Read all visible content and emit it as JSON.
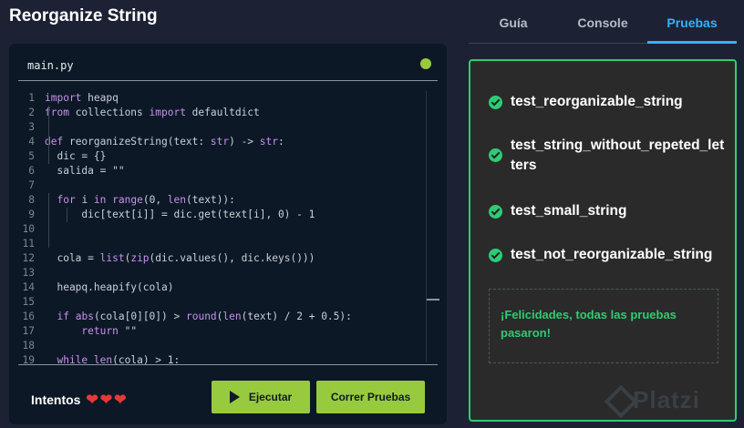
{
  "page_title": "Reorganize String",
  "editor": {
    "file_name": "main.py",
    "lines": [
      {
        "n": "1",
        "html": "<span class=\"kw\">import</span> heapq"
      },
      {
        "n": "2",
        "html": "<span class=\"kw\">from</span> collections <span class=\"kw\">import</span> defaultdict"
      },
      {
        "n": "3",
        "html": ""
      },
      {
        "n": "4",
        "html": "<span class=\"kw\">def</span> reorganizeString(text: <span class=\"kw\">str</span>) -> <span class=\"kw\">str</span>:"
      },
      {
        "n": "5",
        "html": "  dic = {}"
      },
      {
        "n": "6",
        "html": "  salida = \"\""
      },
      {
        "n": "7",
        "html": ""
      },
      {
        "n": "8",
        "html": "  <span class=\"kw\">for</span> i <span class=\"kw\">in</span> <span class=\"kw\">range</span>(0, <span class=\"kw\">len</span>(text)):"
      },
      {
        "n": "9",
        "html": "      dic[text[i]] = dic.get(text[i], 0) - 1"
      },
      {
        "n": "10",
        "html": ""
      },
      {
        "n": "11",
        "html": ""
      },
      {
        "n": "12",
        "html": "  cola = <span class=\"kw\">list</span>(<span class=\"kw\">zip</span>(dic.values(), dic.keys()))"
      },
      {
        "n": "13",
        "html": ""
      },
      {
        "n": "14",
        "html": "  heapq.heapify(cola)"
      },
      {
        "n": "15",
        "html": ""
      },
      {
        "n": "16",
        "html": "  <span class=\"kw\">if</span> <span class=\"kw\">abs</span>(cola[0][0]) > <span class=\"kw\">round</span>(<span class=\"kw\">len</span>(text) / 2 + 0.5):"
      },
      {
        "n": "17",
        "html": "      <span class=\"kw\">return</span> \"\""
      },
      {
        "n": "18",
        "html": ""
      },
      {
        "n": "19",
        "html": "  <span class=\"kw\">while</span> <span class=\"kw\">len</span>(cola) > 1:"
      }
    ]
  },
  "attempts_label": "Intentos",
  "hearts": [
    "❤",
    "❤",
    "❤"
  ],
  "buttons": {
    "run": "Ejecutar",
    "tests": "Correr Pruebas"
  },
  "tabs": [
    {
      "label": "Guía",
      "active": false
    },
    {
      "label": "Console",
      "active": false
    },
    {
      "label": "Pruebas",
      "active": true
    }
  ],
  "tests": [
    {
      "name": "test_reorganizable_string",
      "status": "passed"
    },
    {
      "name": "test_string_without_repeted_letters",
      "status": "passed"
    },
    {
      "name": "test_small_string",
      "status": "passed"
    },
    {
      "name": "test_not_reorganizable_string",
      "status": "passed"
    }
  ],
  "success_message": "¡Felicidades, todas las pruebas pasaron!",
  "watermark": "Platzi",
  "colors": {
    "accent_green": "#98ca3f",
    "success_green": "#2ecc71",
    "tab_active": "#33b1ff",
    "keyword": "#c792ea",
    "heart": "#e53935"
  }
}
